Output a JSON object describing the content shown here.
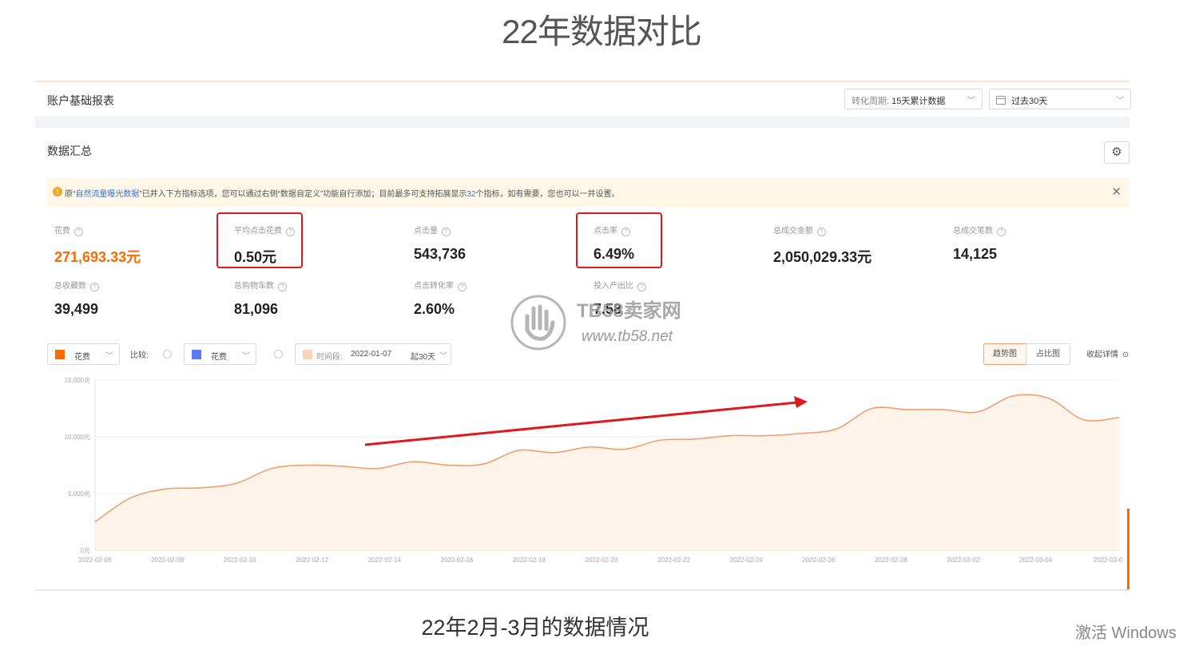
{
  "page_title": "22年数据对比",
  "header": {
    "title": "账户基础报表",
    "period_select": {
      "label": "转化周期:",
      "value": "15天累计数据"
    },
    "date_select": {
      "value": "过去30天"
    }
  },
  "summary": {
    "title": "数据汇总",
    "notice": {
      "part1": "原“",
      "link": "自然流量曝光数据",
      "part2": "”已并入下方指标选项，您可以通过右侧“数据自定义”功能自行添加；目前最多可支持拓展显示",
      "count": "32",
      "part3": "个指标，如有需要，您也可以一并设置。"
    },
    "metrics": [
      {
        "label": "花费",
        "value": "271,693.33元",
        "highlight": true
      },
      {
        "label": "平均点击花费",
        "value": "0.50元",
        "boxed": true
      },
      {
        "label": "点击量",
        "value": "543,736"
      },
      {
        "label": "点击率",
        "value": "6.49%",
        "boxed": true
      },
      {
        "label": "总成交金额",
        "value": "2,050,029.33元"
      },
      {
        "label": "总成交笔数",
        "value": "14,125"
      },
      {
        "label": "总收藏数",
        "value": "39,499"
      },
      {
        "label": "总购物车数",
        "value": "81,096"
      },
      {
        "label": "点击转化率",
        "value": "2.60%"
      },
      {
        "label": "投入产出比",
        "value": "7.58"
      }
    ]
  },
  "controls": {
    "metric1": "花费",
    "compare_label": "比较:",
    "metric2": "花费",
    "period_label": "时间段:",
    "period_start": "2022-01-07",
    "period_span": "起30天",
    "view_trend": "趋势图",
    "view_share": "占比图",
    "collapse": "收起详情"
  },
  "colors": {
    "accent": "#ff6a00",
    "line": "#f0a070",
    "compare": "#5b7cf0",
    "annotation": "#e0191e"
  },
  "watermark": {
    "name": "TB58卖家网",
    "url": "www.tb58.net"
  },
  "chart_data": {
    "type": "area",
    "ylabel": "",
    "ylim": [
      0,
      15000
    ],
    "y_ticks": [
      "0元",
      "5,000元",
      "10,000元",
      "15,000元"
    ],
    "x_tick_labels": [
      "2022-02-06",
      "2022-02-08",
      "2022-02-10",
      "2022-02-12",
      "2022-02-14",
      "2022-02-16",
      "2022-02-18",
      "2022-02-20",
      "2022-02-22",
      "2022-02-24",
      "2022-02-26",
      "2022-02-28",
      "2022-03-02",
      "2022-03-04",
      "2022-03-0"
    ],
    "series": [
      {
        "x": [
          "2022-02-06",
          "2022-02-07",
          "2022-02-08",
          "2022-02-09",
          "2022-02-10",
          "2022-02-11",
          "2022-02-12",
          "2022-02-13",
          "2022-02-14",
          "2022-02-15",
          "2022-02-16",
          "2022-02-17",
          "2022-02-18",
          "2022-02-19",
          "2022-02-20",
          "2022-02-21",
          "2022-02-22",
          "2022-02-23",
          "2022-02-24",
          "2022-02-25",
          "2022-02-26",
          "2022-02-27",
          "2022-02-28",
          "2022-03-01",
          "2022-03-02",
          "2022-03-03",
          "2022-03-04",
          "2022-03-05",
          "2022-03-06",
          "2022-03-07"
        ],
        "values": [
          2500,
          4600,
          5400,
          5500,
          5900,
          7200,
          7500,
          7400,
          7200,
          7800,
          7500,
          7600,
          8800,
          8600,
          9100,
          8900,
          9700,
          9800,
          10100,
          10100,
          10300,
          10700,
          12500,
          12400,
          12400,
          12200,
          13600,
          13400,
          11500,
          11700
        ]
      }
    ],
    "grid": true,
    "annotation": "arrow"
  },
  "caption": "22年2月-3月的数据情况",
  "os_overlay": "激活 Windows"
}
